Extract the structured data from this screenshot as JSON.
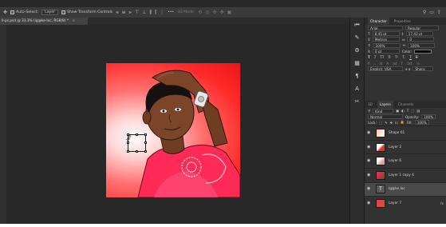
{
  "options_bar": {
    "tool_glyph": "✥",
    "auto_select_label": "Auto-Select:",
    "auto_select_value": "Layer",
    "show_transform_label": "Show Transform Controls",
    "three_d_label": "3D Mode:",
    "more_label": "•••"
  },
  "document": {
    "tab_title": "ll-ps.psd @ 33.3% (ig@ke-loc, RGB/8) *",
    "close_glyph": "×"
  },
  "canvas": {
    "vertical_text": "ig@ke.loc"
  },
  "icon_strip": {
    "icons": [
      "history-icon",
      "brush-preset-icon",
      "adjustments-icon",
      "swatches-icon",
      "paragraph-icon",
      "character-style-icon",
      "tools-icon"
    ]
  },
  "character_panel": {
    "tabs": [
      "Character",
      "Properties"
    ],
    "font_family": "Arial",
    "font_style": "Regular",
    "font_size": "8.45 pt",
    "leading": "17.43 pt",
    "kerning": "Metrics",
    "tracking": "0",
    "vertical_scale": "100%",
    "horizontal_scale": "100%",
    "baseline_shift": "0 pt",
    "color_label": "Color:",
    "style_buttons": [
      "T",
      "T",
      "TT",
      "Tr",
      "T¹",
      "T,",
      "T",
      "T"
    ],
    "opentype_buttons": [
      "fi",
      "ℴ",
      "st",
      "A",
      "ad",
      "T",
      "1st",
      "½"
    ],
    "language": "English: USA",
    "anti_alias": "Sharp",
    "aa_prefix": "a a"
  },
  "layers_panel": {
    "tabs": [
      "3D",
      "Layers",
      "Channels"
    ],
    "filter_label": "Kind",
    "blend_mode": "Normal",
    "opacity_label": "Opacity:",
    "opacity": "100%",
    "lock_label": "Lock:",
    "fill_label": "Fill:",
    "fill": "100%",
    "layers": [
      {
        "name": "Shape 61",
        "type": "shape",
        "selected": false
      },
      {
        "name": "Layer 2",
        "type": "image",
        "selected": false
      },
      {
        "name": "Layer 6",
        "type": "image",
        "selected": false
      },
      {
        "name": "Layer 1 copy 4",
        "type": "image",
        "selected": false
      },
      {
        "name": "ig@ke.loc",
        "type": "text",
        "selected": true
      },
      {
        "name": "Layer 7",
        "type": "fill",
        "selected": false,
        "fx": "fx"
      }
    ]
  },
  "colors": {
    "accent_red": "#ff2222",
    "shirt_pink": "#ff2a6a",
    "panel_bg": "#323232",
    "selected_row": "#4a4a4a"
  }
}
